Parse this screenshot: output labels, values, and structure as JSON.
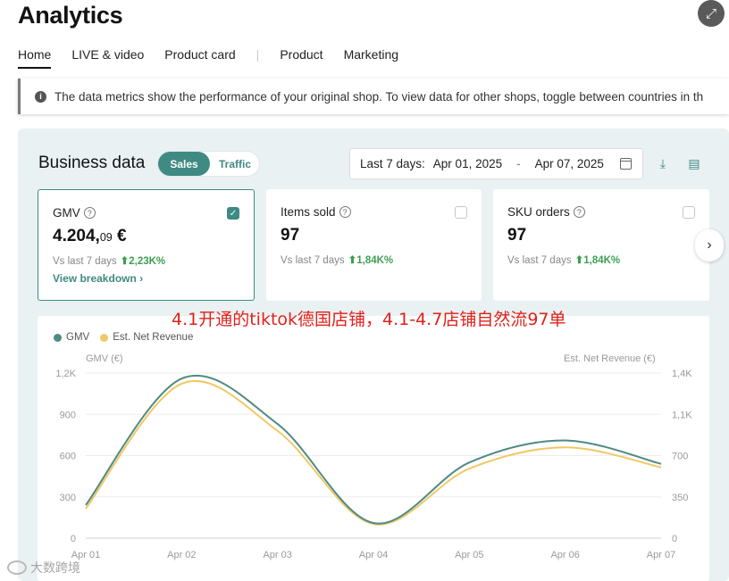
{
  "header": {
    "title": "Analytics",
    "corner_icon": "expand-icon"
  },
  "tabs": [
    {
      "label": "Home",
      "active": true
    },
    {
      "label": "LIVE & video",
      "active": false
    },
    {
      "label": "Product card",
      "active": false
    },
    {
      "label": "Product",
      "active": false
    },
    {
      "label": "Marketing",
      "active": false
    }
  ],
  "banner": {
    "text": "The data metrics show the performance of your original shop. To view data for other shops, toggle between countries in th"
  },
  "business": {
    "title": "Business data",
    "toggle": {
      "sales": "Sales",
      "traffic": "Traffic",
      "selected": "Sales"
    },
    "date": {
      "label": "Last 7 days:",
      "start": "Apr 01, 2025",
      "sep": "-",
      "end": "Apr 07, 2025"
    }
  },
  "cards": [
    {
      "title": "GMV",
      "value_main": "4.204,",
      "value_small": "09",
      "value_unit": " €",
      "cmp_label": "Vs last 7 days",
      "cmp_value": "⬆2,23K%",
      "link": "View breakdown ›",
      "checked": true
    },
    {
      "title": "Items sold",
      "value_main": "97",
      "cmp_label": "Vs last 7 days",
      "cmp_value": "⬆1,84K%",
      "checked": false
    },
    {
      "title": "SKU orders",
      "value_main": "97",
      "cmp_label": "Vs last 7 days",
      "cmp_value": "⬆1,84K%",
      "checked": false
    }
  ],
  "annotation": "4.1开通的tiktok德国店铺，4.1-4.7店铺自然流97单",
  "colors": {
    "gmv": "#4f8a84",
    "net_revenue": "#f0c866",
    "accent": "#3f8a83",
    "annotation": "#e0201a"
  },
  "chart_data": {
    "type": "line",
    "x": [
      "Apr 01",
      "Apr 02",
      "Apr 03",
      "Apr 04",
      "Apr 05",
      "Apr 06",
      "Apr 07"
    ],
    "series": [
      {
        "name": "GMV",
        "axis": "left",
        "values": [
          240,
          1160,
          830,
          110,
          550,
          710,
          540
        ]
      },
      {
        "name": "Est. Net Revenue",
        "axis": "right",
        "values": [
          250,
          1310,
          910,
          120,
          590,
          770,
          600
        ]
      }
    ],
    "ylabel_left": "GMV (€)",
    "ylabel_right": "Est. Net Revenue (€)",
    "left_ticks": [
      "0",
      "300",
      "600",
      "900",
      "1,2K"
    ],
    "right_ticks": [
      "0",
      "350",
      "700",
      "1,1K",
      "1,4K"
    ],
    "ylim_left": [
      0,
      1200
    ],
    "ylim_right": [
      0,
      1400
    ],
    "grid": true,
    "legend": "top-left"
  },
  "watermark": "大数跨境"
}
